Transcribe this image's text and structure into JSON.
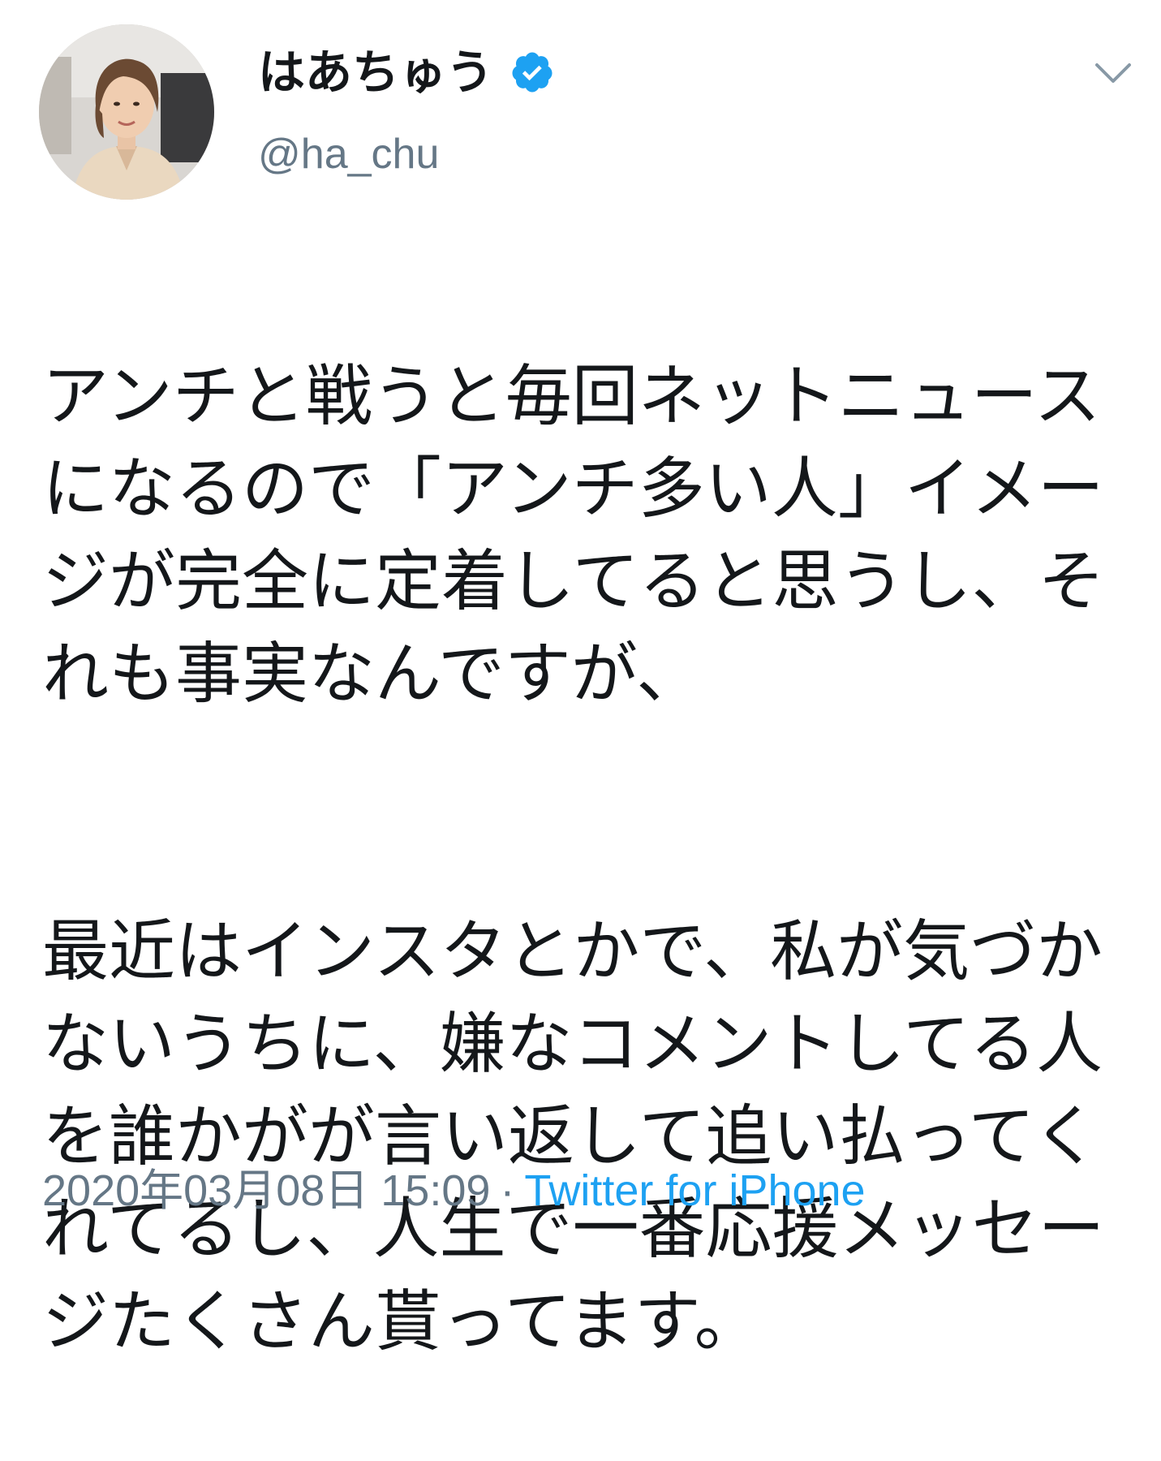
{
  "tweet": {
    "display_name": "はあちゅう",
    "handle": "@ha_chu",
    "verified": true,
    "paragraphs": [
      "アンチと戦うと毎回ネットニュースになるので「アンチ多い人」イメージが完全に定着してると思うし、それも事実なんですが、",
      "最近はインスタとかで、私が気づかないうちに、嫌なコメントしてる人を誰かがが言い返して追い払ってくれてるし、人生で一番応援メッセージたくさん貰ってます。"
    ],
    "timestamp": "2020年03月08日 15:09",
    "separator": "·",
    "source": "Twitter for iPhone"
  },
  "icons": {
    "verified": "verified-badge-icon",
    "menu": "chevron-down-icon"
  },
  "colors": {
    "text": "#14171a",
    "secondary": "#657786",
    "accent": "#1da1f2"
  }
}
